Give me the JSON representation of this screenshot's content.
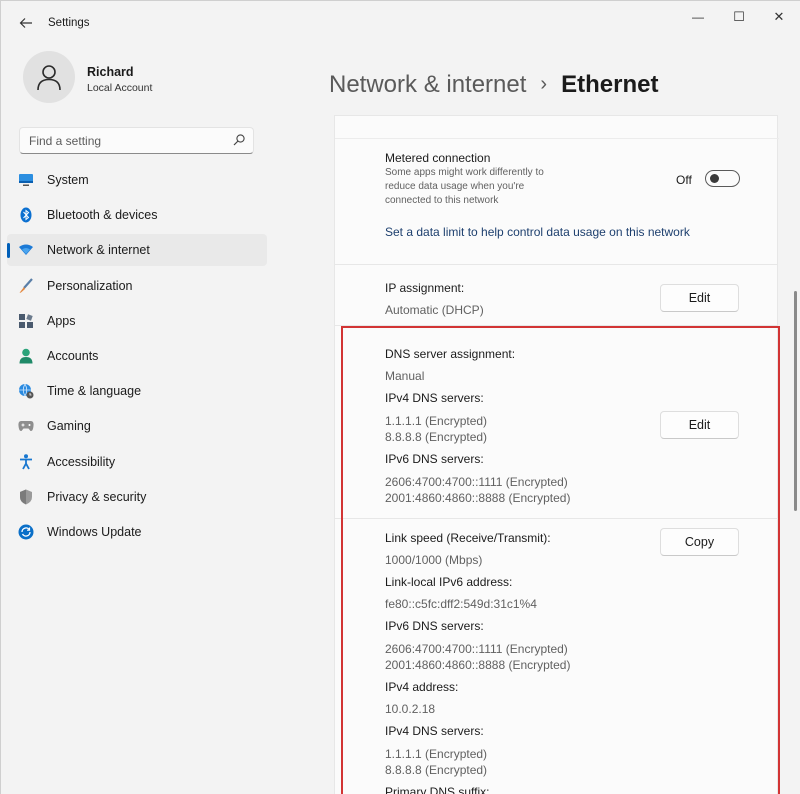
{
  "window": {
    "title": "Settings",
    "controls": {
      "minimize": "—",
      "maximize": "☐",
      "close": "✕"
    }
  },
  "profile": {
    "name": "Richard",
    "account": "Local Account"
  },
  "search": {
    "placeholder": "Find a setting"
  },
  "sidebar": {
    "items": [
      {
        "label": "System",
        "icon": "monitor-icon",
        "color": "#0078d4"
      },
      {
        "label": "Bluetooth & devices",
        "icon": "bluetooth-icon",
        "color": "#0078d4"
      },
      {
        "label": "Network & internet",
        "icon": "wifi-icon",
        "color": "#0078d4",
        "active": true
      },
      {
        "label": "Personalization",
        "icon": "brush-icon",
        "color": "#e07b39"
      },
      {
        "label": "Apps",
        "icon": "apps-icon",
        "color": "#4a5a6e"
      },
      {
        "label": "Accounts",
        "icon": "person-icon",
        "color": "#2aa37a"
      },
      {
        "label": "Time & language",
        "icon": "globe-clock-icon",
        "color": "#1f7bd1"
      },
      {
        "label": "Gaming",
        "icon": "gamepad-icon",
        "color": "#8a8a8a"
      },
      {
        "label": "Accessibility",
        "icon": "accessibility-icon",
        "color": "#1877d0"
      },
      {
        "label": "Privacy & security",
        "icon": "shield-icon",
        "color": "#8c8c8c"
      },
      {
        "label": "Windows Update",
        "icon": "update-icon",
        "color": "#0a6fc8"
      }
    ]
  },
  "header": {
    "parent": "Network & internet",
    "separator": "›",
    "current": "Ethernet"
  },
  "metered": {
    "title": "Metered connection",
    "description": "Some apps might work differently to reduce data usage when you're connected to this network",
    "toggle_state": "Off",
    "link": "Set a data limit to help control data usage on this network"
  },
  "ip": {
    "label": "IP assignment:",
    "value": "Automatic (DHCP)",
    "button": "Edit"
  },
  "dns": {
    "label": "DNS server assignment:",
    "value": "Manual",
    "ipv4_label": "IPv4 DNS servers:",
    "ipv4_values": [
      "1.1.1.1 (Encrypted)",
      "8.8.8.8 (Encrypted)"
    ],
    "ipv6_label": "IPv6 DNS servers:",
    "ipv6_values": [
      "2606:4700:4700::1111 (Encrypted)",
      "2001:4860:4860::8888 (Encrypted)"
    ],
    "button": "Edit"
  },
  "properties": {
    "button": "Copy",
    "link_speed_label": "Link speed (Receive/Transmit):",
    "link_speed_value": "1000/1000 (Mbps)",
    "link_local_label": "Link-local IPv6 address:",
    "link_local_value": "fe80::c5fc:dff2:549d:31c1%4",
    "ipv6_dns_label": "IPv6 DNS servers:",
    "ipv6_dns_values": [
      "2606:4700:4700::1111 (Encrypted)",
      "2001:4860:4860::8888 (Encrypted)"
    ],
    "ipv4_label": "IPv4 address:",
    "ipv4_value": "10.0.2.18",
    "ipv4_dns_label": "IPv4 DNS servers:",
    "ipv4_dns_values": [
      "1.1.1.1 (Encrypted)",
      "8.8.8.8 (Encrypted)"
    ],
    "dns_suffix_label": "Primary DNS suffix:"
  },
  "colors": {
    "accent": "#005fb8",
    "highlight_border": "#d23434",
    "link": "#1d3f6e"
  }
}
